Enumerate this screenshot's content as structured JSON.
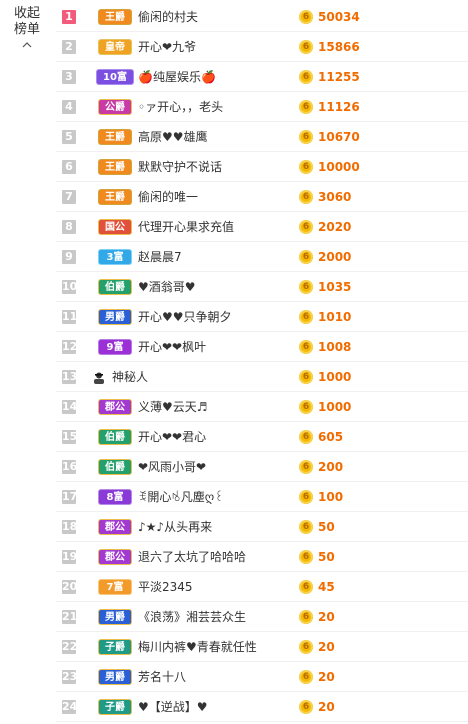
{
  "collapse": {
    "label": "收起榜单"
  },
  "rows": [
    {
      "rank": "1",
      "badge": "王爵",
      "badge_type": "wang",
      "name": "偷闲的村夫",
      "score": "50034"
    },
    {
      "rank": "2",
      "badge": "皇帝",
      "badge_type": "huang",
      "name": "开心❤九爷",
      "score": "15866"
    },
    {
      "rank": "3",
      "badge": "10富",
      "badge_type": "fu10",
      "name": "🍎纯屋娱乐🍎",
      "score": "11255"
    },
    {
      "rank": "4",
      "badge": "公爵",
      "badge_type": "gong",
      "name": "◦ァ开心，，老头",
      "score": "11126"
    },
    {
      "rank": "5",
      "badge": "王爵",
      "badge_type": "wang",
      "name": "高原♥♥雄鹰",
      "score": "10670"
    },
    {
      "rank": "6",
      "badge": "王爵",
      "badge_type": "wang",
      "name": "默默守护不说话",
      "score": "10000"
    },
    {
      "rank": "7",
      "badge": "王爵",
      "badge_type": "wang",
      "name": "偷闲的唯一",
      "score": "3060"
    },
    {
      "rank": "8",
      "badge": "国公",
      "badge_type": "guogong",
      "name": "代理开心果求充值",
      "score": "2020"
    },
    {
      "rank": "9",
      "badge": "3富",
      "badge_type": "fu3",
      "name": "赵晨晨7",
      "score": "2000"
    },
    {
      "rank": "10",
      "badge": "伯爵",
      "badge_type": "bo",
      "name": "♥酒翁哥♥",
      "score": "1035"
    },
    {
      "rank": "11",
      "badge": "男爵",
      "badge_type": "nan",
      "name": "开心♥♥只争朝夕",
      "score": "1010"
    },
    {
      "rank": "12",
      "badge": "9富",
      "badge_type": "fu9",
      "name": "开心❤❤枫叶",
      "score": "1008"
    },
    {
      "rank": "13",
      "badge": "",
      "badge_type": "mystery",
      "name": "神秘人",
      "score": "1000"
    },
    {
      "rank": "14",
      "badge": "郡公",
      "badge_type": "junggong",
      "name": "义薄♥云天♬",
      "score": "1000"
    },
    {
      "rank": "15",
      "badge": "伯爵",
      "badge_type": "bo",
      "name": "开心❤❤君心",
      "score": "605"
    },
    {
      "rank": "16",
      "badge": "伯爵",
      "badge_type": "bo",
      "name": "❤风雨小哥❤",
      "score": "200"
    },
    {
      "rank": "17",
      "badge": "8富",
      "badge_type": "fu8",
      "name": "ꉂ開心ꂚ凡塵ღ꒰",
      "score": "100"
    },
    {
      "rank": "18",
      "badge": "郡公",
      "badge_type": "junggong",
      "name": "♪★♪从头再来",
      "score": "50"
    },
    {
      "rank": "19",
      "badge": "郡公",
      "badge_type": "junggong",
      "name": "退六了太坑了哈哈哈",
      "score": "50"
    },
    {
      "rank": "20",
      "badge": "7富",
      "badge_type": "fu7",
      "name": "平淡2345",
      "score": "45"
    },
    {
      "rank": "21",
      "badge": "男爵",
      "badge_type": "nan",
      "name": "《浪荡》湘芸芸众生",
      "score": "20"
    },
    {
      "rank": "22",
      "badge": "子爵",
      "badge_type": "zi",
      "name": "梅川内裤♥青春就任性",
      "score": "20"
    },
    {
      "rank": "23",
      "badge": "男爵",
      "badge_type": "nan",
      "name": "芳名十八",
      "score": "20"
    },
    {
      "rank": "24",
      "badge": "子爵",
      "badge_type": "zi",
      "name": "♥【逆战】♥",
      "score": "20"
    }
  ],
  "colors": {
    "accent": "#f06c00",
    "rank_top": "#f25b7c",
    "rank_default": "#c8c8c8"
  }
}
